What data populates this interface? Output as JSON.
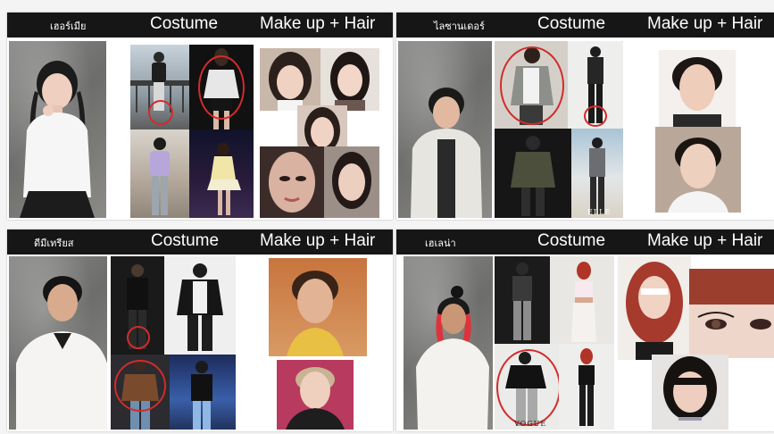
{
  "boards": [
    {
      "name": "เฮอร์เมีย",
      "costume_label": "Costume",
      "makeup_label": "Make up + Hair"
    },
    {
      "name": "ไลซานเดอร์",
      "costume_label": "Costume",
      "makeup_label": "Make up + Hair"
    },
    {
      "name": "ดีมีเทรียส",
      "costume_label": "Costume",
      "makeup_label": "Make up + Hair"
    },
    {
      "name": "เฮเลน่า",
      "costume_label": "Costume",
      "makeup_label": "Make up + Hair"
    }
  ],
  "magazine_marks": {
    "elle": "ELLE",
    "vogue": "VOGUE"
  },
  "colors": {
    "header_bg": "#161616",
    "highlight_circle": "#d22b2b",
    "backdrop_grey": "#7a7a78"
  }
}
